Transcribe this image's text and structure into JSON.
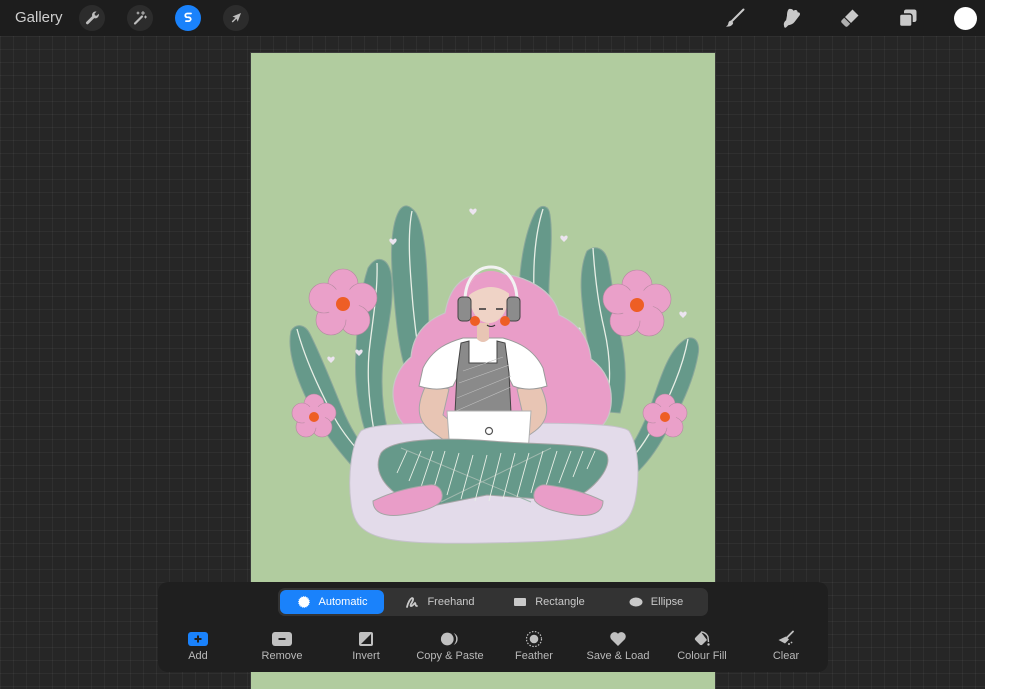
{
  "topbar": {
    "gallery_label": "Gallery",
    "left_tools": [
      {
        "name": "actions",
        "icon": "wrench-icon"
      },
      {
        "name": "adjustments",
        "icon": "magic-wand-icon"
      },
      {
        "name": "selection",
        "icon": "selection-s-icon",
        "active": true
      },
      {
        "name": "transform",
        "icon": "arrow-cursor-icon"
      }
    ],
    "right_tools": [
      {
        "name": "paint",
        "icon": "brush-icon"
      },
      {
        "name": "smudge",
        "icon": "smudge-finger-icon"
      },
      {
        "name": "erase",
        "icon": "eraser-icon"
      },
      {
        "name": "layers",
        "icon": "layers-icon"
      }
    ],
    "current_colour": "#ffffff"
  },
  "colors": {
    "accent": "#1a82fb",
    "canvas_bg": "#b1cc9f",
    "leaf": "#66998a",
    "flower": "#eaa0c9",
    "flower_center": "#ee5e25",
    "hair": "#e99dc8",
    "cushion": "#e3dbea"
  },
  "selection_panel": {
    "modes": [
      {
        "label": "Automatic",
        "icon": "sparkle-circle-icon",
        "active": true
      },
      {
        "label": "Freehand",
        "icon": "freehand-squiggle-icon",
        "active": false
      },
      {
        "label": "Rectangle",
        "icon": "rectangle-icon",
        "active": false
      },
      {
        "label": "Ellipse",
        "icon": "ellipse-icon",
        "active": false
      }
    ],
    "actions": [
      {
        "label": "Add",
        "icon": "plus-square-icon"
      },
      {
        "label": "Remove",
        "icon": "minus-square-icon"
      },
      {
        "label": "Invert",
        "icon": "invert-icon"
      },
      {
        "label": "Copy & Paste",
        "icon": "copy-paste-icon"
      },
      {
        "label": "Feather",
        "icon": "feather-dotted-circle-icon"
      },
      {
        "label": "Save & Load",
        "icon": "heart-icon"
      },
      {
        "label": "Colour Fill",
        "icon": "fill-bucket-icon"
      },
      {
        "label": "Clear",
        "icon": "clear-broom-icon"
      }
    ]
  }
}
